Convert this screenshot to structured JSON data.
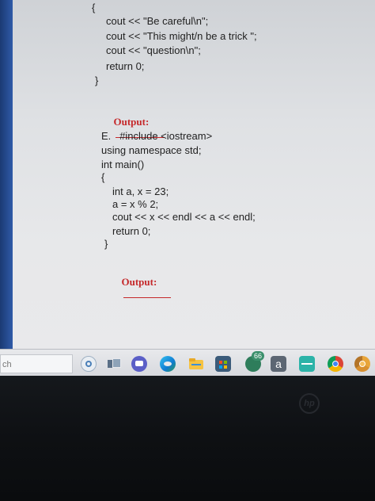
{
  "document": {
    "snippet_d_lines": [
      "{",
      "cout << \"Be careful\\n\";",
      "cout << \"This might/n be a trick \";",
      "cout << \"question\\n\";",
      "return 0;",
      "}"
    ],
    "output_label_d": "Output:",
    "snippet_e_lines": [
      "E.   #include <iostream>",
      "using namespace std;",
      "int main()",
      "{",
      "int a, x = 23;",
      "a = x % 2;",
      "cout << x << endl << a << endl;",
      "return 0;",
      "}"
    ],
    "output_label_e": "Output:"
  },
  "taskbar": {
    "search_text": "ch",
    "notification_count": "66",
    "amazon_letter": "a",
    "icons": [
      "cortana-icon",
      "task-view-icon",
      "chat-icon",
      "edge-icon",
      "file-explorer-icon",
      "store-icon",
      "app-icon",
      "amazon-icon",
      "app-teal-icon",
      "chrome-icon",
      "chrome-canary-icon"
    ]
  },
  "laptop": {
    "brand": "hp"
  }
}
